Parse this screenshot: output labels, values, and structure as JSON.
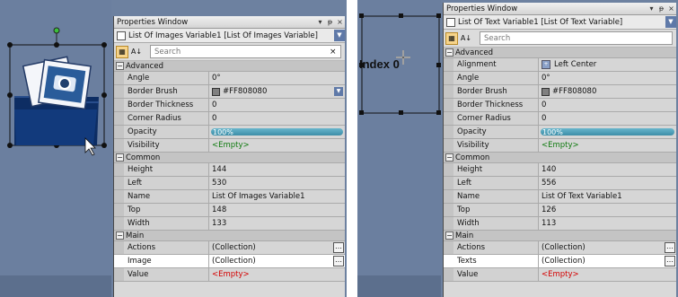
{
  "left": {
    "window_title": "Properties Window",
    "object_name": "List Of Images Variable1 [List Of Images Variable]",
    "search_placeholder": "Search",
    "search_clear": "×",
    "categories": {
      "advanced": "Advanced",
      "common": "Common",
      "main": "Main"
    },
    "advanced": [
      {
        "name": "Angle",
        "value": "0°"
      },
      {
        "name": "Border Brush",
        "value": "#FF808080"
      },
      {
        "name": "Border Thickness",
        "value": "0"
      },
      {
        "name": "Corner Radius",
        "value": "0"
      },
      {
        "name": "Opacity",
        "value": "100%"
      },
      {
        "name": "Visibility",
        "value": "<Empty>"
      }
    ],
    "common": [
      {
        "name": "Height",
        "value": "144"
      },
      {
        "name": "Left",
        "value": "530"
      },
      {
        "name": "Name",
        "value": "List Of Images Variable1"
      },
      {
        "name": "Top",
        "value": "148"
      },
      {
        "name": "Width",
        "value": "133"
      }
    ],
    "main": [
      {
        "name": "Actions",
        "value": "(Collection)"
      },
      {
        "name": "Image",
        "value": "(Collection)"
      },
      {
        "name": "Value",
        "value": "<Empty>"
      }
    ]
  },
  "right": {
    "window_title": "Properties Window",
    "object_name": "List Of Text Variable1 [List Of Text Variable]",
    "search_placeholder": "Search",
    "canvas_label": "Index 0",
    "categories": {
      "advanced": "Advanced",
      "common": "Common",
      "main": "Main"
    },
    "advanced": [
      {
        "name": "Alignment",
        "value": "Left Center"
      },
      {
        "name": "Angle",
        "value": "0°"
      },
      {
        "name": "Border Brush",
        "value": "#FF808080"
      },
      {
        "name": "Border Thickness",
        "value": "0"
      },
      {
        "name": "Corner Radius",
        "value": "0"
      },
      {
        "name": "Opacity",
        "value": "100%"
      },
      {
        "name": "Visibility",
        "value": "<Empty>"
      }
    ],
    "common": [
      {
        "name": "Height",
        "value": "140"
      },
      {
        "name": "Left",
        "value": "556"
      },
      {
        "name": "Name",
        "value": "List Of Text Variable1"
      },
      {
        "name": "Top",
        "value": "126"
      },
      {
        "name": "Width",
        "value": "113"
      }
    ],
    "main": [
      {
        "name": "Actions",
        "value": "(Collection)"
      },
      {
        "name": "Texts",
        "value": "(Collection)"
      },
      {
        "name": "Value",
        "value": "<Empty>"
      }
    ]
  },
  "title_buttons": {
    "pin": "▾",
    "autohide": "ᵽ",
    "close": "×"
  },
  "collapse_glyph": "−",
  "ellipsis": "…",
  "colors": {
    "accent": "#5f79a8",
    "opacity_bar": "#3d8ea8",
    "highlight": "#ffffff",
    "canvas": "#6b7f9f"
  }
}
